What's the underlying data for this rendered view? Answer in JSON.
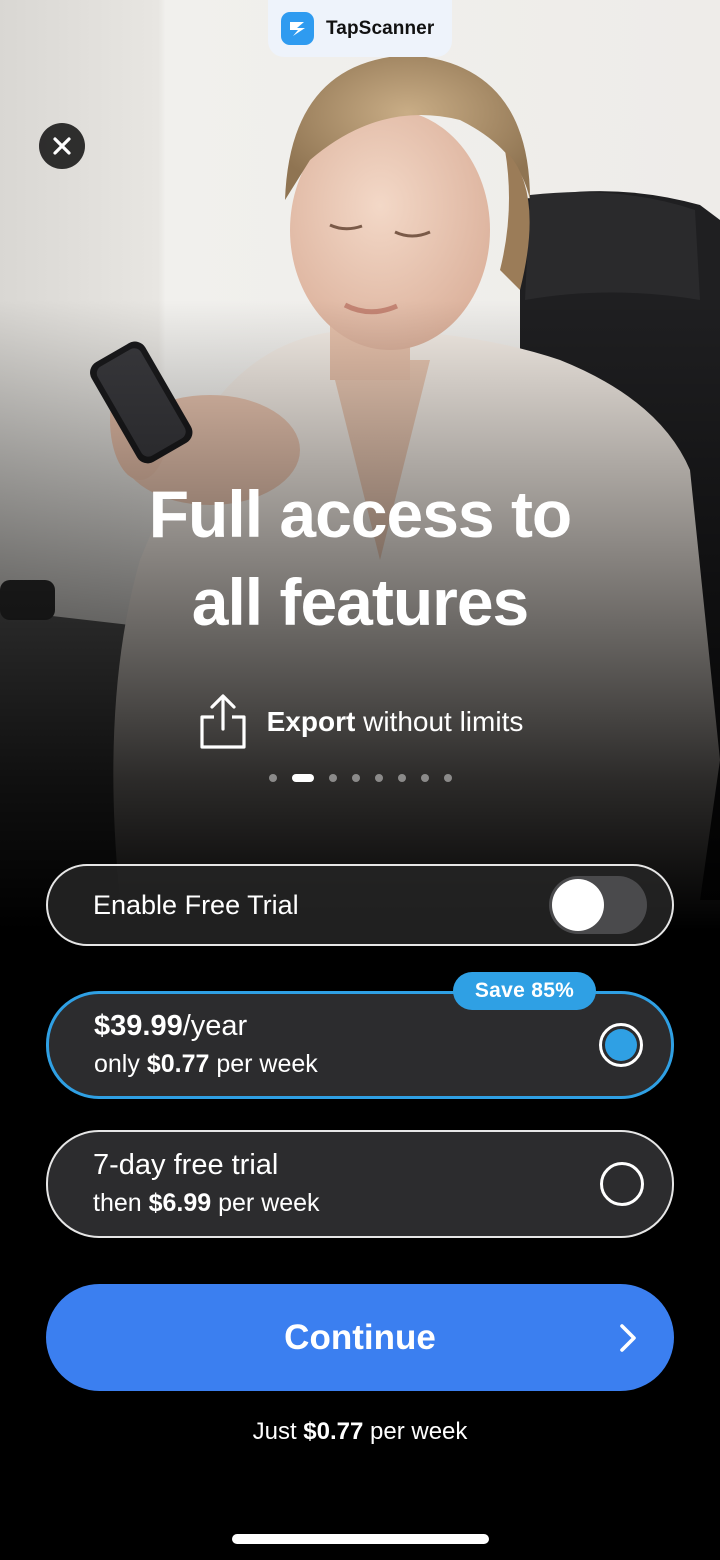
{
  "app": {
    "name": "TapScanner",
    "logo_icon": "tapscanner-logo-icon",
    "brand_color": "#2f9bf0"
  },
  "close": {
    "icon": "close-icon"
  },
  "hero": {
    "headline_line1": "Full access to",
    "headline_line2": "all features",
    "feature": {
      "icon": "share-export-icon",
      "bold": "Export",
      "rest": " without limits"
    },
    "carousel": {
      "total_pages": 8,
      "active_index": 1
    }
  },
  "trial_toggle": {
    "label": "Enable Free Trial",
    "enabled": false
  },
  "plans": [
    {
      "id": "yearly",
      "price": "$39.99",
      "period": "/year",
      "sub_prefix": "only ",
      "sub_price": "$0.77",
      "sub_suffix": " per week",
      "badge": "Save 85%",
      "selected": true
    },
    {
      "id": "weekly",
      "title": "7-day free trial",
      "sub_prefix": "then ",
      "sub_price": "$6.99",
      "sub_suffix": " per week",
      "selected": false
    }
  ],
  "continue_button": {
    "label": "Continue",
    "icon": "chevron-right-icon"
  },
  "footnote": {
    "prefix": "Just ",
    "price": "$0.77",
    "suffix": " per week"
  },
  "colors": {
    "accent_blue": "#3b7ff0",
    "selected_blue": "#2fa0e4",
    "card_bg": "#2c2c2e",
    "background": "#000000"
  }
}
